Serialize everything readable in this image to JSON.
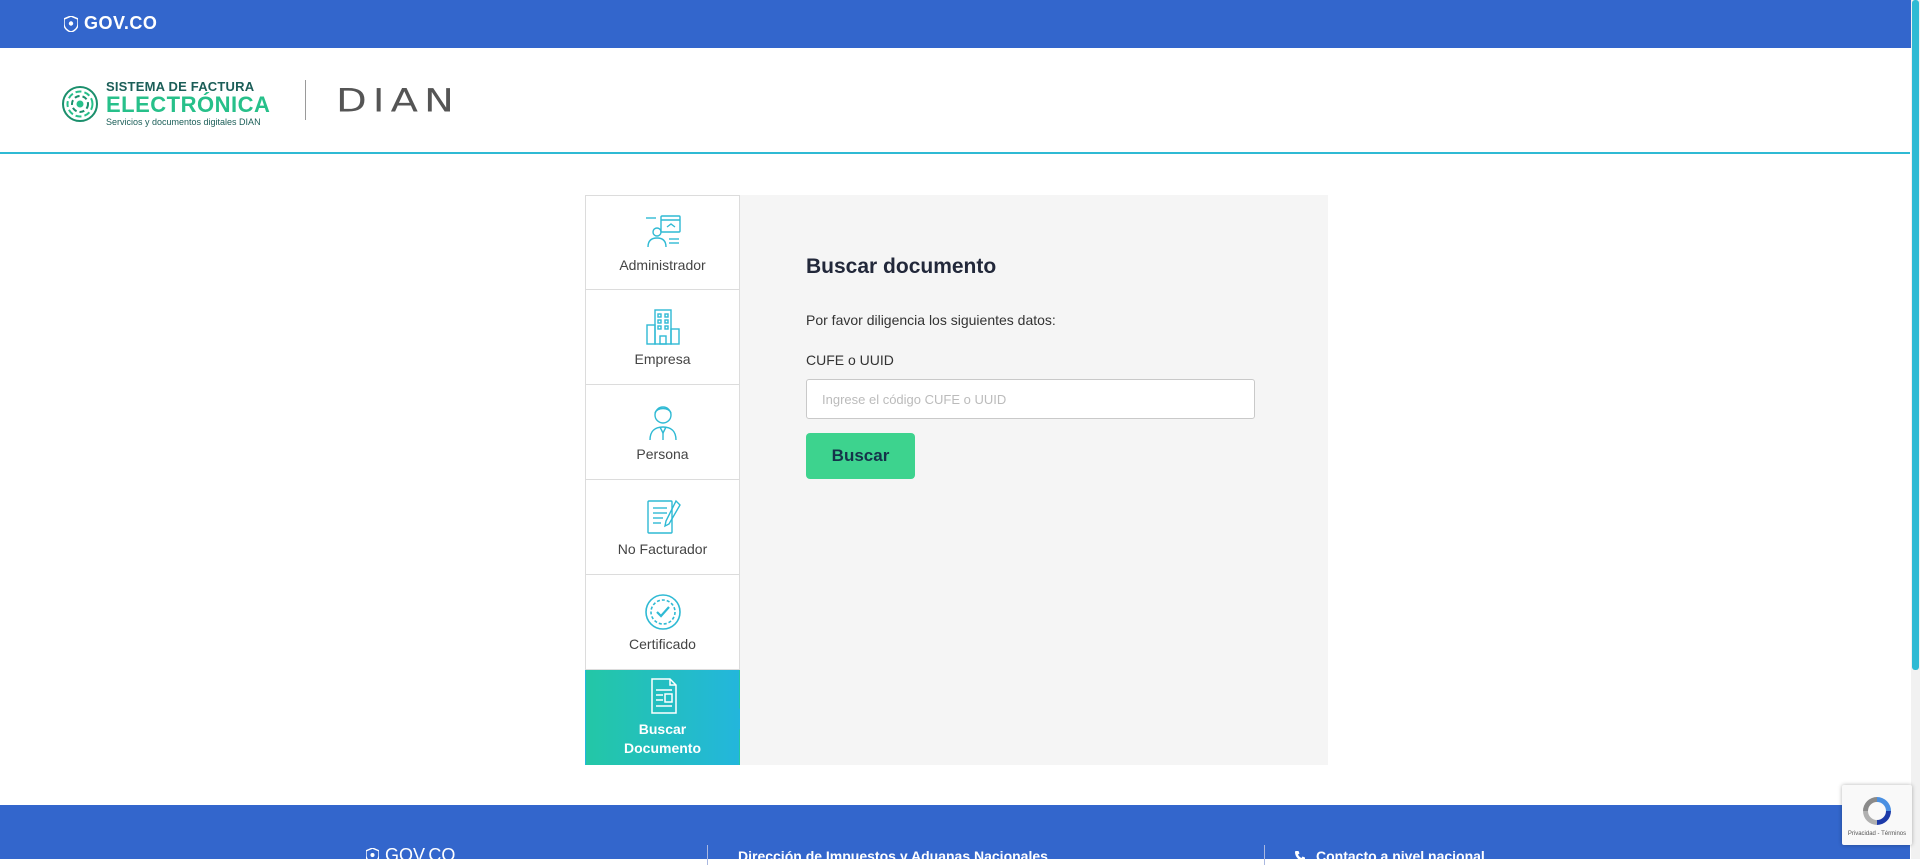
{
  "gov_bar": {
    "logo_text": "GOV.CO"
  },
  "header": {
    "brand_line1": "SISTEMA DE FACTURA",
    "brand_line2": "ELECTRÓNICA",
    "brand_line3": "Servicios y documentos digitales DIAN",
    "dian_logo": "DIAN"
  },
  "sidebar": {
    "items": [
      {
        "label": "Administrador",
        "icon": "admin-icon"
      },
      {
        "label": "Empresa",
        "icon": "building-icon"
      },
      {
        "label": "Persona",
        "icon": "person-icon"
      },
      {
        "label": "No Facturador",
        "icon": "document-pen-icon"
      },
      {
        "label": "Certificado",
        "icon": "certificate-check-icon"
      },
      {
        "label_line1": "Buscar",
        "label_line2": "Documento",
        "icon": "document-search-icon",
        "active": true
      }
    ]
  },
  "panel": {
    "title": "Buscar documento",
    "subtitle": "Por favor diligencia los siguientes datos:",
    "field_label": "CUFE o UUID",
    "field_placeholder": "Ingrese el código CUFE o UUID",
    "field_value": "",
    "button_label": "Buscar"
  },
  "footer": {
    "logo_text": "GOV.CO",
    "dian_text": "Dirección de Impuestos y Aduanas Nacionales",
    "contact_text": "Contacto a nivel nacional"
  },
  "recaptcha": {
    "text": "Privacidad - Términos"
  },
  "colors": {
    "gov_blue": "#3366cc",
    "accent_teal": "#2fbad4",
    "button_green": "#3dd38e",
    "brand_green": "#27c08a"
  }
}
